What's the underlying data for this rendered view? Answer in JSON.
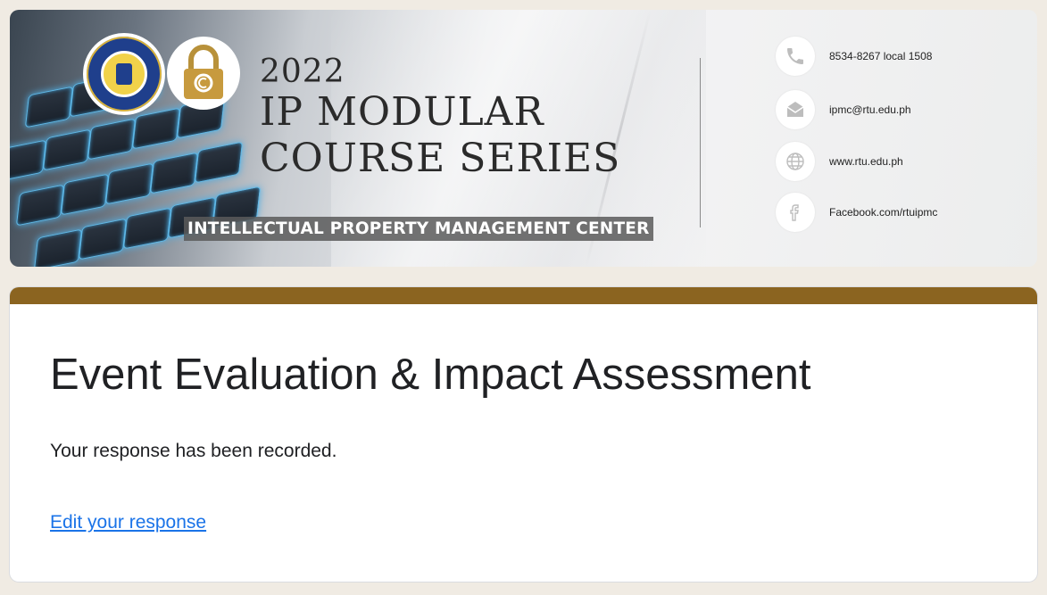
{
  "banner": {
    "year": "2022",
    "title_line1": "IP MODULAR",
    "title_line2": "COURSE SERIES",
    "center_name": "INTELLECTUAL PROPERTY MANAGEMENT CENTER",
    "contacts": [
      {
        "icon": "phone-icon",
        "text": "8534-8267 local 1508"
      },
      {
        "icon": "envelope-icon",
        "text": "ipmc@rtu.edu.ph"
      },
      {
        "icon": "globe-icon",
        "text": "www.rtu.edu.ph"
      },
      {
        "icon": "facebook-icon",
        "text": "Facebook.com/rtuipmc"
      }
    ]
  },
  "form": {
    "title": "Event Evaluation & Impact Assessment",
    "confirmation": "Your response has been recorded.",
    "edit_link": "Edit your response"
  },
  "colors": {
    "accent_bar": "#8b6420",
    "link": "#1a73e8",
    "page_bg": "#f0ebe3"
  }
}
